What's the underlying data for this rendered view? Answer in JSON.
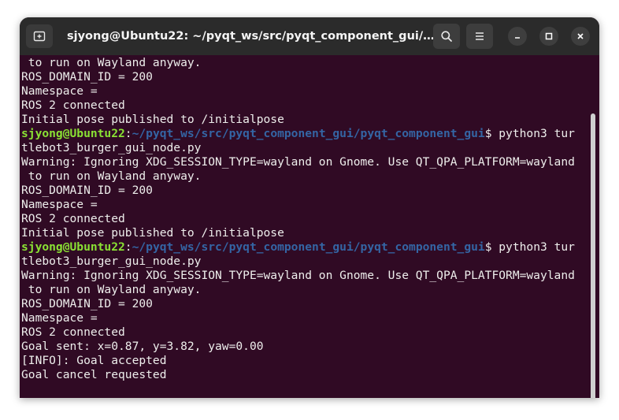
{
  "window": {
    "title": "sjyong@Ubuntu22: ~/pyqt_ws/src/pyqt_component_gui/pyqt..."
  },
  "icons": {
    "new_tab": "new-tab-icon",
    "search": "search-icon",
    "menu": "hamburger-menu-icon",
    "minimize": "minimize-icon",
    "maximize": "maximize-icon",
    "close": "close-icon"
  },
  "colors": {
    "terminal_bg": "#300a24",
    "titlebar_bg": "#2b2b2b",
    "prompt_user": "#8ae234",
    "prompt_path": "#3465a4",
    "text": "#eeeeec"
  },
  "terminal": {
    "lines": [
      {
        "text": " to run on Wayland anyway."
      },
      {
        "text": "ROS_DOMAIN_ID = 200"
      },
      {
        "text": "Namespace = "
      },
      {
        "text": "ROS 2 connected"
      },
      {
        "text": "Initial pose published to /initialpose"
      },
      {
        "prompt_user": "sjyong@Ubuntu22",
        "prompt_colon": ":",
        "prompt_path": "~/pyqt_ws/src/pyqt_component_gui/pyqt_component_gui",
        "text": "$ python3 tur"
      },
      {
        "text": "tlebot3_burger_gui_node.py"
      },
      {
        "text": "Warning: Ignoring XDG_SESSION_TYPE=wayland on Gnome. Use QT_QPA_PLATFORM=wayland"
      },
      {
        "text": " to run on Wayland anyway."
      },
      {
        "text": "ROS_DOMAIN_ID = 200"
      },
      {
        "text": "Namespace = "
      },
      {
        "text": "ROS 2 connected"
      },
      {
        "text": "Initial pose published to /initialpose"
      },
      {
        "prompt_user": "sjyong@Ubuntu22",
        "prompt_colon": ":",
        "prompt_path": "~/pyqt_ws/src/pyqt_component_gui/pyqt_component_gui",
        "text": "$ python3 tur"
      },
      {
        "text": "tlebot3_burger_gui_node.py"
      },
      {
        "text": "Warning: Ignoring XDG_SESSION_TYPE=wayland on Gnome. Use QT_QPA_PLATFORM=wayland"
      },
      {
        "text": " to run on Wayland anyway."
      },
      {
        "text": "ROS_DOMAIN_ID = 200"
      },
      {
        "text": "Namespace = "
      },
      {
        "text": "ROS 2 connected"
      },
      {
        "text": "Goal sent: x=0.87, y=3.82, yaw=0.00"
      },
      {
        "text": "[INFO]: Goal accepted"
      },
      {
        "text": "Goal cancel requested"
      }
    ]
  }
}
